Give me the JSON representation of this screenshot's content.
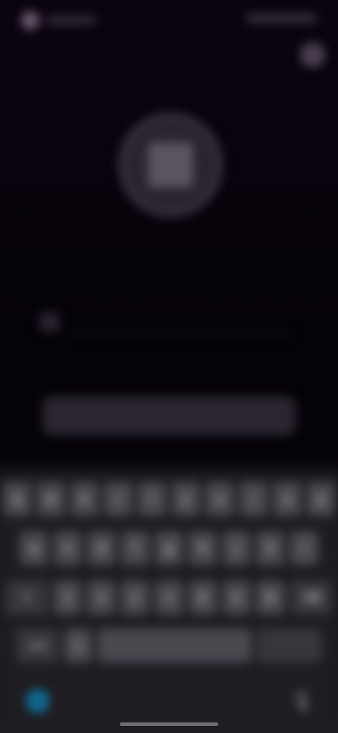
{
  "status": {
    "time": "",
    "icons": ""
  },
  "header": {
    "title": "",
    "subtitle": ""
  },
  "input": {
    "value": "",
    "placeholder": ""
  },
  "primary_button": {
    "label": ""
  },
  "keyboard": {
    "row1": [
      "q",
      "w",
      "e",
      "r",
      "t",
      "y",
      "u",
      "i",
      "o",
      "p"
    ],
    "row2": [
      "a",
      "s",
      "d",
      "f",
      "g",
      "h",
      "j",
      "k",
      "l"
    ],
    "row3": [
      "z",
      "x",
      "c",
      "v",
      "b",
      "n",
      "m"
    ],
    "shift_icon": "⇧",
    "delete_icon": "⌫",
    "numbers_label": "123",
    "emoji_icon": "☺",
    "space_label": "",
    "return_label": "",
    "globe_icon": "🌐",
    "mic_icon": "🎙"
  },
  "colors": {
    "background": "#050208",
    "keyboard_bg": "#1f1d22",
    "key_bg": "#4a474f"
  }
}
